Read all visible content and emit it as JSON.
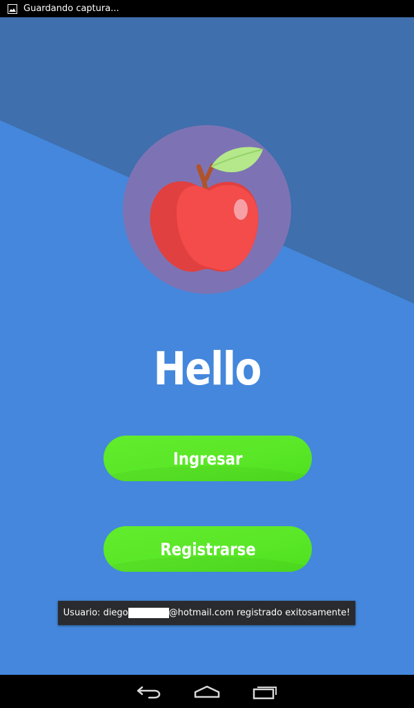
{
  "status_bar": {
    "notification_icon": "image-icon",
    "text": "Guardando captura..."
  },
  "app": {
    "background_color": "#4487dc",
    "logo_icon": "apple-icon",
    "title": "Hello",
    "buttons": {
      "login_label": "Ingresar",
      "register_label": "Registrarse"
    },
    "toast": {
      "prefix": "Usuario: diego",
      "suffix": "@hotmail.com registrado exitosamente!"
    }
  },
  "nav_bar": {
    "back_icon": "back-icon",
    "home_icon": "home-icon",
    "recents_icon": "recents-icon"
  }
}
